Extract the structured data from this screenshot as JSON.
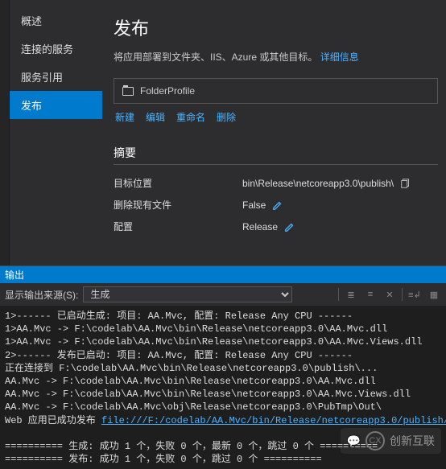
{
  "sidebar": {
    "items": [
      {
        "label": "概述"
      },
      {
        "label": "连接的服务"
      },
      {
        "label": "服务引用"
      },
      {
        "label": "发布"
      }
    ]
  },
  "publish": {
    "title": "发布",
    "subtitle": "将应用部署到文件夹、IIS、Azure 或其他目标。",
    "learnMore": "详细信息",
    "profileName": "FolderProfile",
    "actions": {
      "new": "新建",
      "edit": "编辑",
      "rename": "重命名",
      "delete": "删除"
    },
    "summaryHeader": "摘要",
    "summary": {
      "targetLabel": "目标位置",
      "targetValue": "bin\\Release\\netcoreapp3.0\\publish\\",
      "deleteLabel": "删除现有文件",
      "deleteValue": "False",
      "configLabel": "配置",
      "configValue": "Release"
    }
  },
  "output": {
    "panelTitle": "输出",
    "sourceLabel": "显示输出来源(S):",
    "sourceValue": "生成",
    "lines": [
      "1>------ 已启动生成: 项目: AA.Mvc, 配置: Release Any CPU ------",
      "1>AA.Mvc -> F:\\codelab\\AA.Mvc\\bin\\Release\\netcoreapp3.0\\AA.Mvc.dll",
      "1>AA.Mvc -> F:\\codelab\\AA.Mvc\\bin\\Release\\netcoreapp3.0\\AA.Mvc.Views.dll",
      "2>------ 发布已启动: 项目: AA.Mvc, 配置: Release Any CPU ------",
      "正在连接到 F:\\codelab\\AA.Mvc\\bin\\Release\\netcoreapp3.0\\publish\\...",
      "AA.Mvc -> F:\\codelab\\AA.Mvc\\bin\\Release\\netcoreapp3.0\\AA.Mvc.dll",
      "AA.Mvc -> F:\\codelab\\AA.Mvc\\bin\\Release\\netcoreapp3.0\\AA.Mvc.Views.dll",
      "AA.Mvc -> F:\\codelab\\AA.Mvc\\obj\\Release\\netcoreapp3.0\\PubTmp\\Out\\"
    ],
    "webLinePrefix": "Web 应用已成功发布 ",
    "webUrl": "file:///F:/codelab/AA.Mvc/bin/Release/netcoreapp3.0/publish/",
    "summary1": "========== 生成: 成功 1 个，失败 0 个，最新 0 个，跳过 0 个 ==========",
    "summary2": "========== 发布: 成功 1 个，失败 0 个，跳过 0 个 =========="
  },
  "watermark": "创新互联"
}
